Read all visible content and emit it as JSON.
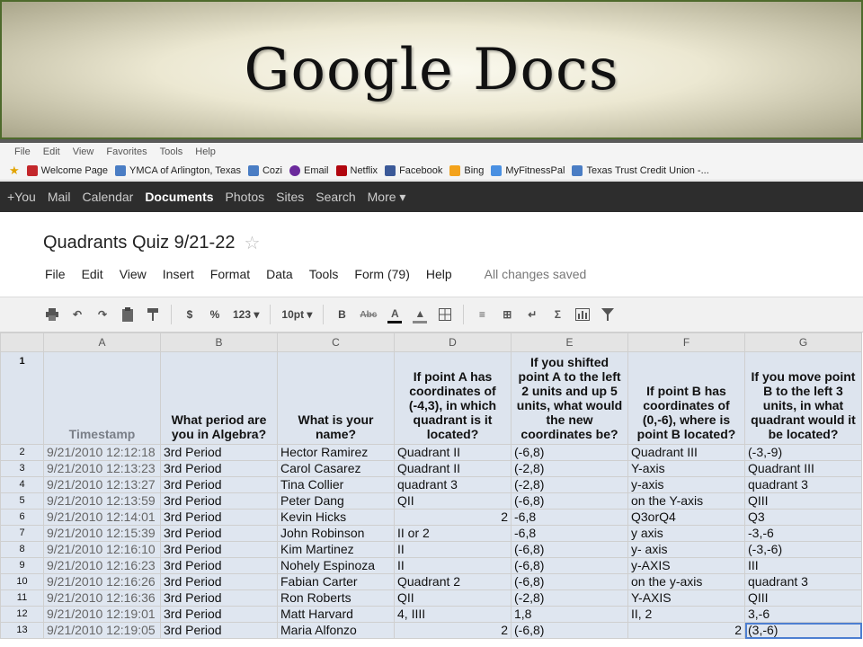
{
  "slide": {
    "title": "Google Docs"
  },
  "browser": {
    "menu": [
      "File",
      "Edit",
      "View",
      "Favorites",
      "Tools",
      "Help"
    ],
    "favorites": [
      {
        "label": "Welcome Page",
        "icon": "e-page-icon",
        "color": "#c3272b"
      },
      {
        "label": "YMCA of Arlington, Texas",
        "icon": "page-icon",
        "color": "#4a7dc4"
      },
      {
        "label": "Cozi",
        "icon": "page-icon",
        "color": "#4a7dc4"
      },
      {
        "label": "Email",
        "icon": "yahoo-icon",
        "color": "#6b2a9c"
      },
      {
        "label": "Netflix",
        "icon": "netflix-icon",
        "color": "#b1060f"
      },
      {
        "label": "Facebook",
        "icon": "facebook-icon",
        "color": "#3b5998"
      },
      {
        "label": "Bing",
        "icon": "bing-icon",
        "color": "#f3a21b"
      },
      {
        "label": "MyFitnessPal",
        "icon": "mfp-icon",
        "color": "#4a90e2"
      },
      {
        "label": "Texas Trust Credit Union -...",
        "icon": "page-icon",
        "color": "#4a7dc4"
      }
    ]
  },
  "gbar": {
    "items": [
      "+You",
      "Mail",
      "Calendar",
      "Documents",
      "Photos",
      "Sites",
      "Search",
      "More ▾"
    ],
    "active": "Documents"
  },
  "doc": {
    "title": "Quadrants Quiz 9/21-22",
    "menu": [
      "File",
      "Edit",
      "View",
      "Insert",
      "Format",
      "Data",
      "Tools",
      "Form (79)",
      "Help"
    ],
    "status": "All changes saved"
  },
  "toolbar": {
    "currency": "$",
    "percent": "%",
    "number_format": "123 ▾",
    "font_size": "10pt ▾",
    "bold": "B",
    "strike": "Abc"
  },
  "sheet": {
    "columns": [
      "A",
      "B",
      "C",
      "D",
      "E",
      "F",
      "G"
    ],
    "headers": [
      "Timestamp",
      "What period are you in Algebra?",
      "What is your name?",
      "If point A has coordinates of (-4,3), in which quadrant is it located?",
      "If you shifted point A to the left 2 units and up 5 units, what would the new coordinates be?",
      "If point B has coordinates of (0,-6), where is point B located?",
      "If you move point B to the left 3 units, in what quadrant would it be located?"
    ],
    "rows": [
      {
        "n": "2",
        "cells": [
          "9/21/2010 12:12:18",
          "3rd Period",
          "Hector Ramirez",
          "Quadrant II",
          "(-6,8)",
          "Quadrant III",
          "(-3,-9)"
        ]
      },
      {
        "n": "3",
        "cells": [
          "9/21/2010 12:13:23",
          "3rd Period",
          "Carol Casarez",
          "Quadrant II",
          "(-2,8)",
          "Y-axis",
          "Quadrant III"
        ]
      },
      {
        "n": "4",
        "cells": [
          "9/21/2010 12:13:27",
          "3rd Period",
          "Tina Collier",
          "quadrant 3",
          "(-2,8)",
          "y-axis",
          "quadrant 3"
        ]
      },
      {
        "n": "5",
        "cells": [
          "9/21/2010 12:13:59",
          "3rd Period",
          "Peter Dang",
          "QII",
          "(-6,8)",
          "on the Y-axis",
          "QIII"
        ]
      },
      {
        "n": "6",
        "cells": [
          "9/21/2010 12:14:01",
          "3rd Period",
          "Kevin Hicks",
          "2",
          "-6,8",
          "Q3orQ4",
          "Q3"
        ]
      },
      {
        "n": "7",
        "cells": [
          "9/21/2010 12:15:39",
          "3rd Period",
          "John Robinson",
          "II or 2",
          "-6,8",
          "y axis",
          "-3,-6"
        ]
      },
      {
        "n": "8",
        "cells": [
          "9/21/2010 12:16:10",
          "3rd Period",
          "Kim Martinez",
          "II",
          "(-6,8)",
          "y- axis",
          "(-3,-6)"
        ]
      },
      {
        "n": "9",
        "cells": [
          "9/21/2010 12:16:23",
          "3rd Period",
          "Nohely Espinoza",
          "II",
          "(-6,8)",
          "y-AXIS",
          "III"
        ]
      },
      {
        "n": "10",
        "cells": [
          "9/21/2010 12:16:26",
          "3rd Period",
          "Fabian Carter",
          "Quadrant 2",
          "(-6,8)",
          "on the y-axis",
          "quadrant 3"
        ]
      },
      {
        "n": "11",
        "cells": [
          "9/21/2010 12:16:36",
          "3rd Period",
          "Ron Roberts",
          "QII",
          "(-2,8)",
          "Y-AXIS",
          "QIII"
        ]
      },
      {
        "n": "12",
        "cells": [
          "9/21/2010 12:19:01",
          "3rd Period",
          "Matt Harvard",
          "4, IIII",
          "1,8",
          "II, 2",
          "3,-6"
        ]
      },
      {
        "n": "13",
        "cells": [
          "9/21/2010 12:19:05",
          "3rd Period",
          "Maria Alfonzo",
          "2",
          "(-6,8)",
          "2",
          "(3,-6)"
        ]
      }
    ]
  }
}
